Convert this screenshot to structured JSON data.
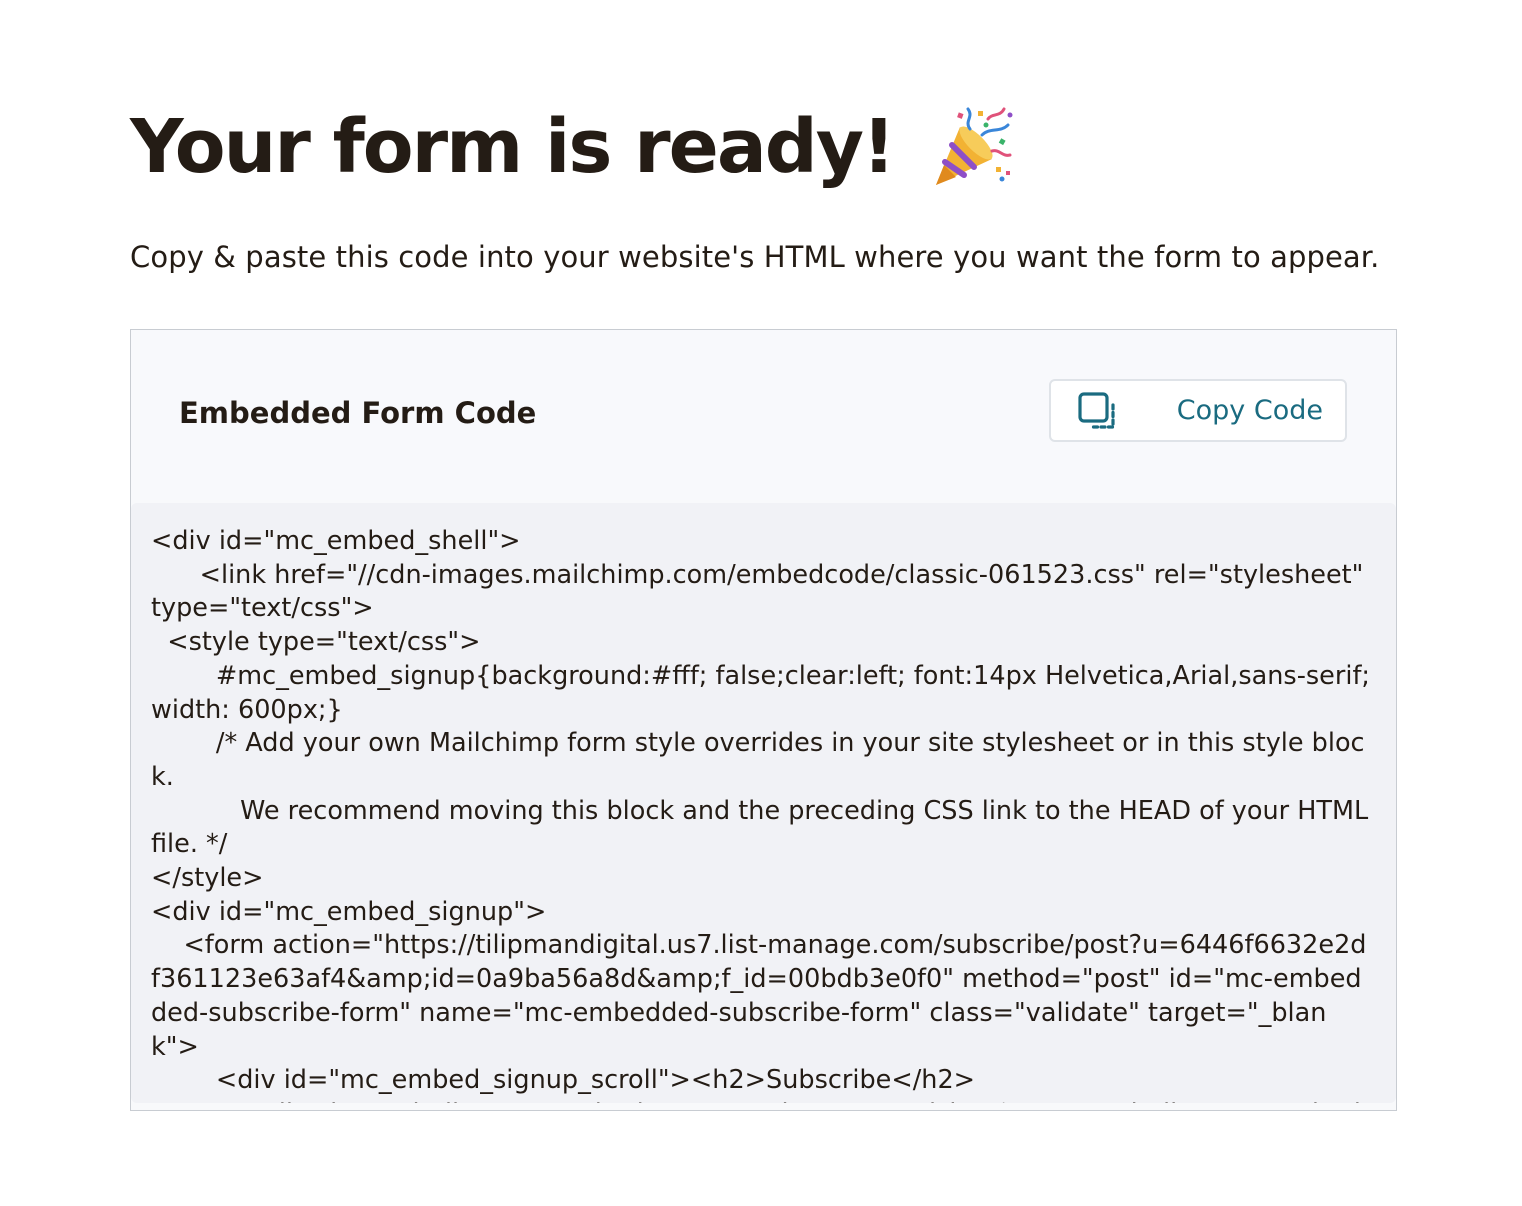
{
  "header": {
    "title": "Your form is ready!",
    "title_icon": "party-popper-icon",
    "subtitle": "Copy & paste this code into your website's HTML where you want the form to appear."
  },
  "panel": {
    "title": "Embedded Form Code",
    "copy_button": {
      "label": "Copy Code",
      "icon": "copy-icon"
    },
    "code": "<div id=\"mc_embed_shell\">\n      <link href=\"//cdn-images.mailchimp.com/embedcode/classic-061523.css\" rel=\"stylesheet\" type=\"text/css\">\n  <style type=\"text/css\">\n        #mc_embed_signup{background:#fff; false;clear:left; font:14px Helvetica,Arial,sans-serif; width: 600px;}\n        /* Add your own Mailchimp form style overrides in your site stylesheet or in this style block.\n           We recommend moving this block and the preceding CSS link to the HEAD of your HTML file. */\n</style>\n<div id=\"mc_embed_signup\">\n    <form action=\"https://tilipmandigital.us7.list-manage.com/subscribe/post?u=6446f6632e2df361123e63af4&amp;id=0a9ba56a8d&amp;f_id=00bdb3e0f0\" method=\"post\" id=\"mc-embedded-subscribe-form\" name=\"mc-embedded-subscribe-form\" class=\"validate\" target=\"_blank\">\n        <div id=\"mc_embed_signup_scroll\"><h2>Subscribe</h2>\n            <div class=\"indicates-required\"><span class=\"asterisk\">*</span> indicates required</div>"
  },
  "colors": {
    "text": "#241c15",
    "accent": "#1a6b80",
    "panel_bg": "#f8f9fb",
    "code_bg": "#f1f2f6"
  }
}
